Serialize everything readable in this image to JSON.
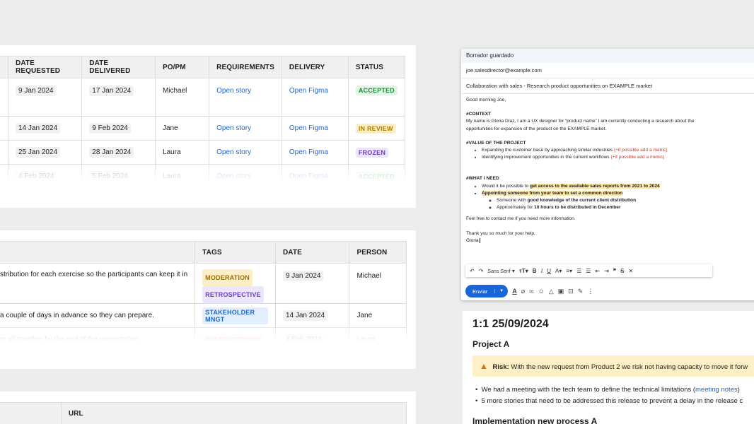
{
  "table1": {
    "headers": [
      "DATE REQUESTED",
      "DATE DELIVERED",
      "PO/PM",
      "REQUIREMENTS",
      "DELIVERY",
      "STATUS"
    ],
    "rows": [
      {
        "requested": "9 Jan 2024",
        "delivered": "17 Jan 2024",
        "pm": "Michael",
        "req": "Open story",
        "delivery": "Open Figma",
        "status": "ACCEPTED"
      },
      {
        "requested": "14 Jan 2024",
        "delivered": "9 Feb 2024",
        "pm": "Jane",
        "req": "Open story",
        "delivery": "Open Figma",
        "status": "IN REVIEW"
      },
      {
        "requested": "25 Jan 2024",
        "delivered": "28 Jan 2024",
        "pm": "Laura",
        "req": "Open story",
        "delivery": "Open Figma",
        "status": "FROZEN"
      },
      {
        "requested": "4 Feb 2024",
        "delivered": "5 Feb 2024",
        "pm": "Laura",
        "req": "Open story",
        "delivery": "Open Figma",
        "status": "ACCEPTED"
      }
    ],
    "status_colors": {
      "accepted_fg": "#1e8a3a",
      "accepted_bg": "#e3f4e6",
      "review_fg": "#b07a00",
      "review_bg": "#fbefc8",
      "frozen_fg": "#6b3fc8",
      "frozen_bg": "#ece5fb"
    }
  },
  "table2": {
    "headers": [
      "TAGS",
      "DATE",
      "PERSON"
    ],
    "rows": [
      {
        "text": "stribution for each exercise so the participants can keep it in",
        "tags": [
          "MODERATION",
          "RETROSPECTIVE"
        ],
        "date": "9 Jan 2024",
        "person": "Michael"
      },
      {
        "text": "a couple of days in advance so they can prepare.",
        "tags": [
          "STAKEHOLDER MNGT"
        ],
        "date": "14 Jan 2024",
        "person": "Jane"
      },
      {
        "text": "m all together by the end of the presentation.",
        "tags": [
          "PRESENTATIONS"
        ],
        "date": "4 Feb 2024",
        "person": "Laura"
      }
    ]
  },
  "table3": {
    "headers": [
      "URL"
    ]
  },
  "email": {
    "header": "Borrador guardado",
    "to": "joe.salesdirector@example.com",
    "subject": "Collaboration with sales - Research product opportunities on EXAMPLE market",
    "greeting": "Good morning Joe,",
    "context_title": "#CONTEXT",
    "context_text": "My name is Gloria Díaz, I am a UX designer for “product name” I am currently conducting a research about the opportunities for expansion of the product on the EXAMPLE market.",
    "value_title": "#VALUE OF THE PROJECT",
    "value_items": [
      {
        "text": "Expanding the customer base by approaching similar industries ",
        "note": "(+if possible add a metric)"
      },
      {
        "text": "Identifying improvement opportunities in the current workflows  ",
        "note": "(+if possible add a metric)"
      }
    ],
    "need_title": "#WHAT I NEED",
    "need_1_pre": "Would it be possible to ",
    "need_1_hl": "get access to the available sales reports from 2021 to 2024",
    "need_2_hl": "Appointing someone from your team to set a common direction",
    "sub_1_pre": "Someone with ",
    "sub_1_bold": "good knowledge of the current client distribution",
    "sub_2_pre": "Approximately for ",
    "sub_2_bold": "10 hours to be distributed in December",
    "closing": "Feel free to contact me if you need more information.",
    "thanks": "Thank you so much for your help,",
    "signature": "Gloria",
    "font": "Sans Serif",
    "send_label": "Enviar"
  },
  "notes": {
    "title": "1:1 25/09/2024",
    "project": "Project A",
    "risk_label": "Risk:",
    "risk_text": " With the new request from Product 2 we risk not having capacity to move it forw",
    "bullet_1_pre": "We had a meeting with the tech team to define the technical limitations (",
    "bullet_1_link": "meeting notes",
    "bullet_1_post": ")",
    "bullet_2": "5 more stories that need to be addressed this release to prevent a delay in the release c",
    "section_2": "Implementation new process A"
  }
}
